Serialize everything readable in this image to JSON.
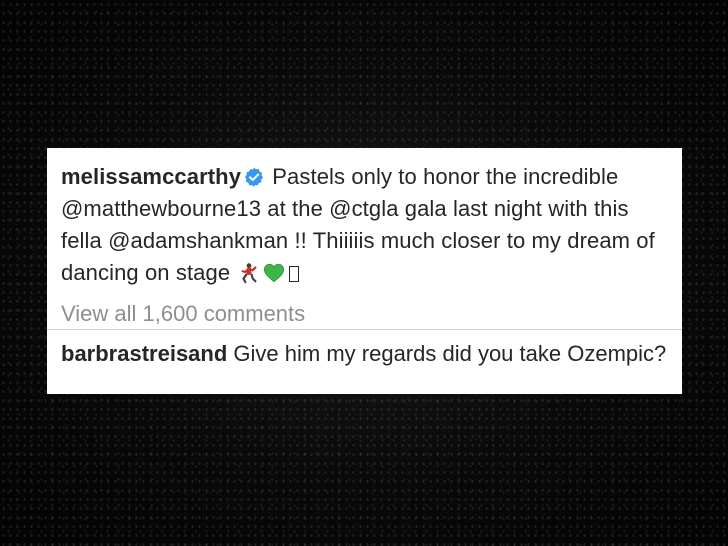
{
  "post": {
    "author": "melissamccarthy",
    "verified_icon": "verified-badge-icon",
    "caption_parts": {
      "text_1": "Pastels only to honor the incredible ",
      "mention_1": "@matthewbourne13",
      "text_2": " at the ",
      "mention_2": "@ctgla",
      "text_3": " gala last night with this fella ",
      "mention_3": "@adamshankman",
      "text_4": " !! Thiiiiis much closer to my dream of dancing on stage "
    },
    "emojis": [
      "man-dancing-emoji",
      "green-heart-emoji",
      "missing-glyph"
    ],
    "view_all_comments": "View all 1,600 comments"
  },
  "comment": {
    "author": "barbrastreisand",
    "text": "Give him my regards did you take Ozempic?"
  },
  "colors": {
    "background": "#060606",
    "card": "#ffffff",
    "text": "#262626",
    "muted": "#8e8e8e",
    "verified_blue": "#3897f0",
    "heart_green": "#3fb449"
  }
}
